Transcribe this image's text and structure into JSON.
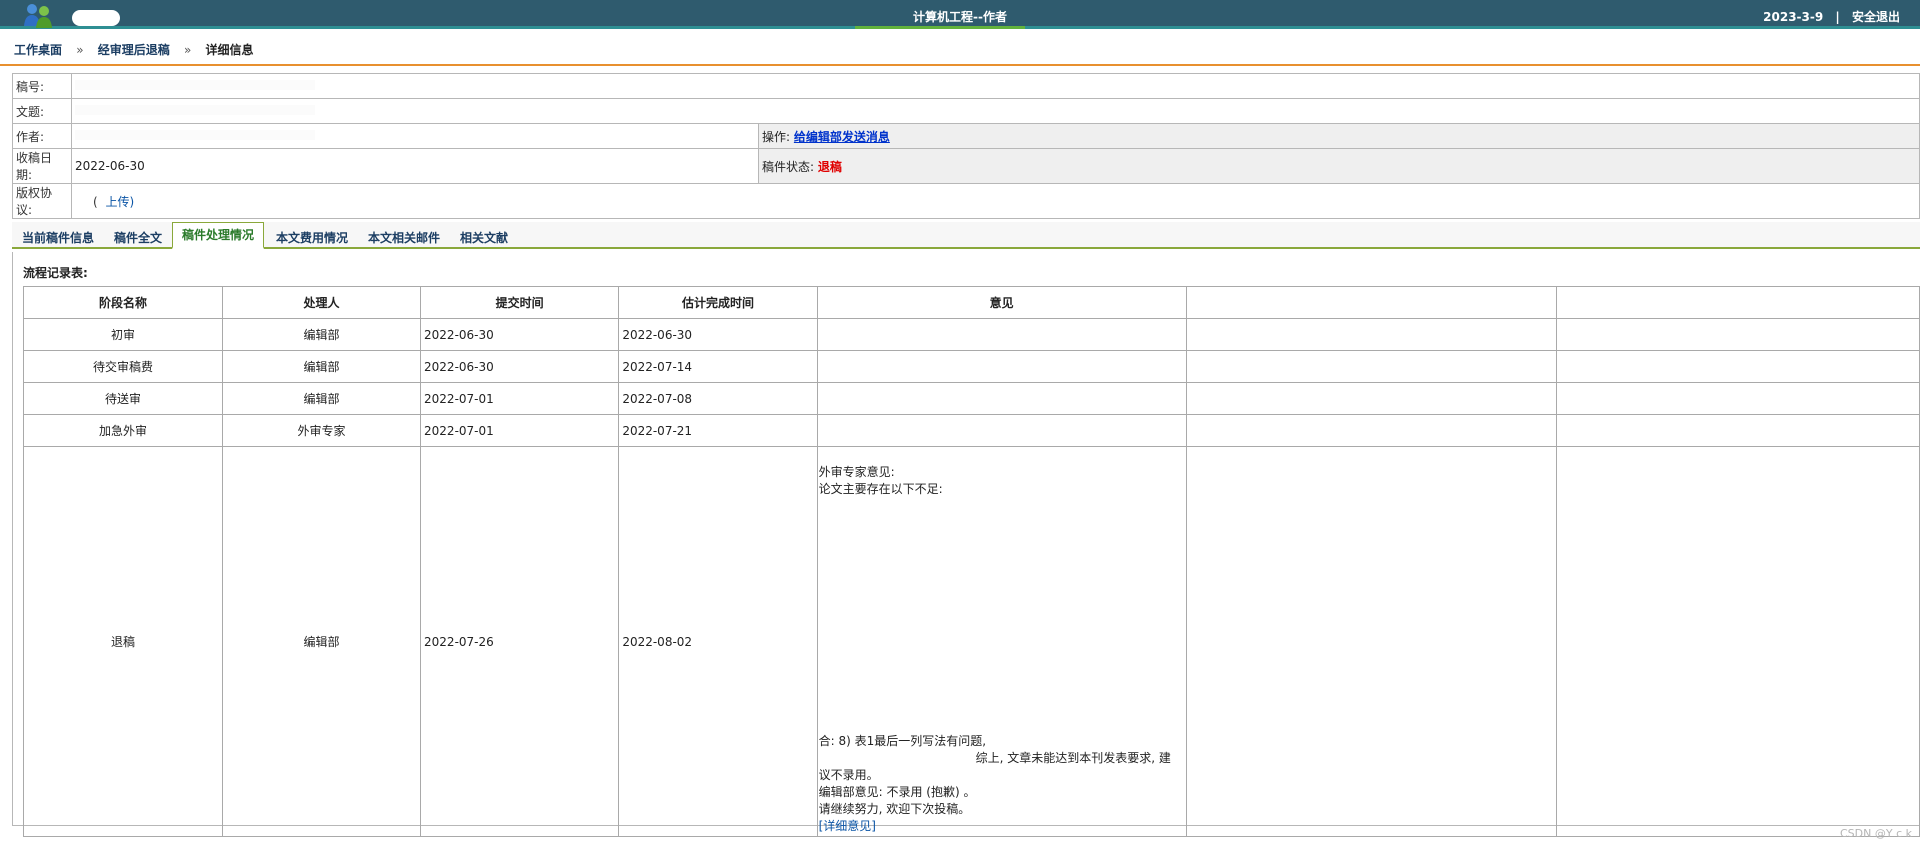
{
  "header": {
    "title": "计算机工程--作者",
    "date": "2023-3-9",
    "separator": "|",
    "logout": "安全退出"
  },
  "breadcrumb": {
    "items": [
      "工作桌面",
      "经审理后退稿"
    ],
    "arrow": "»",
    "current": "详细信息"
  },
  "info": {
    "manuscript_no_label": "稿号:",
    "title_label": "文题:",
    "author_label": "作者:",
    "action_label": "操作:",
    "action_link": "给编辑部发送消息",
    "received_label": "收稿日期:",
    "received_value": "2022-06-30",
    "status_label": "稿件状态:",
    "status_value": "退稿",
    "copyright_label": "版权协议:",
    "copyright_open": "(",
    "copyright_link": "上传)",
    "status_color": "#e00000"
  },
  "tabs": [
    "当前稿件信息",
    "稿件全文",
    "稿件处理情况",
    "本文费用情况",
    "本文相关邮件",
    "相关文献"
  ],
  "process": {
    "title": "流程记录表:",
    "headers": [
      "阶段名称",
      "处理人",
      "提交时间",
      "估计完成时间",
      "意见"
    ],
    "rows": [
      {
        "stage": "初审",
        "handler": "编辑部",
        "submitted": "2022-06-30",
        "due": "2022-06-30"
      },
      {
        "stage": "待交审稿费",
        "handler": "编辑部",
        "submitted": "2022-06-30",
        "due": "2022-07-14"
      },
      {
        "stage": "待送审",
        "handler": "编辑部",
        "submitted": "2022-07-01",
        "due": "2022-07-08"
      },
      {
        "stage": "加急外审",
        "handler": "外审专家",
        "submitted": "2022-07-01",
        "due": "2022-07-21"
      },
      {
        "stage": "退稿",
        "handler": "编辑部",
        "submitted": "2022-07-26",
        "due": "2022-08-02"
      }
    ],
    "opinion": {
      "line1": "外审专家意见:",
      "line2": "论文主要存在以下不足:",
      "line3": "合: 8) 表1最后一列写法有问题,",
      "line4": "综上, 文章未能达到本刊发表要求, 建",
      "line5": "议不录用。",
      "line6": "编辑部意见: 不录用 (抱歉) 。",
      "line7": "请继续努力, 欢迎下次投稿。",
      "link": "[详细意见]"
    }
  },
  "watermark": "CSDN @Y c k"
}
